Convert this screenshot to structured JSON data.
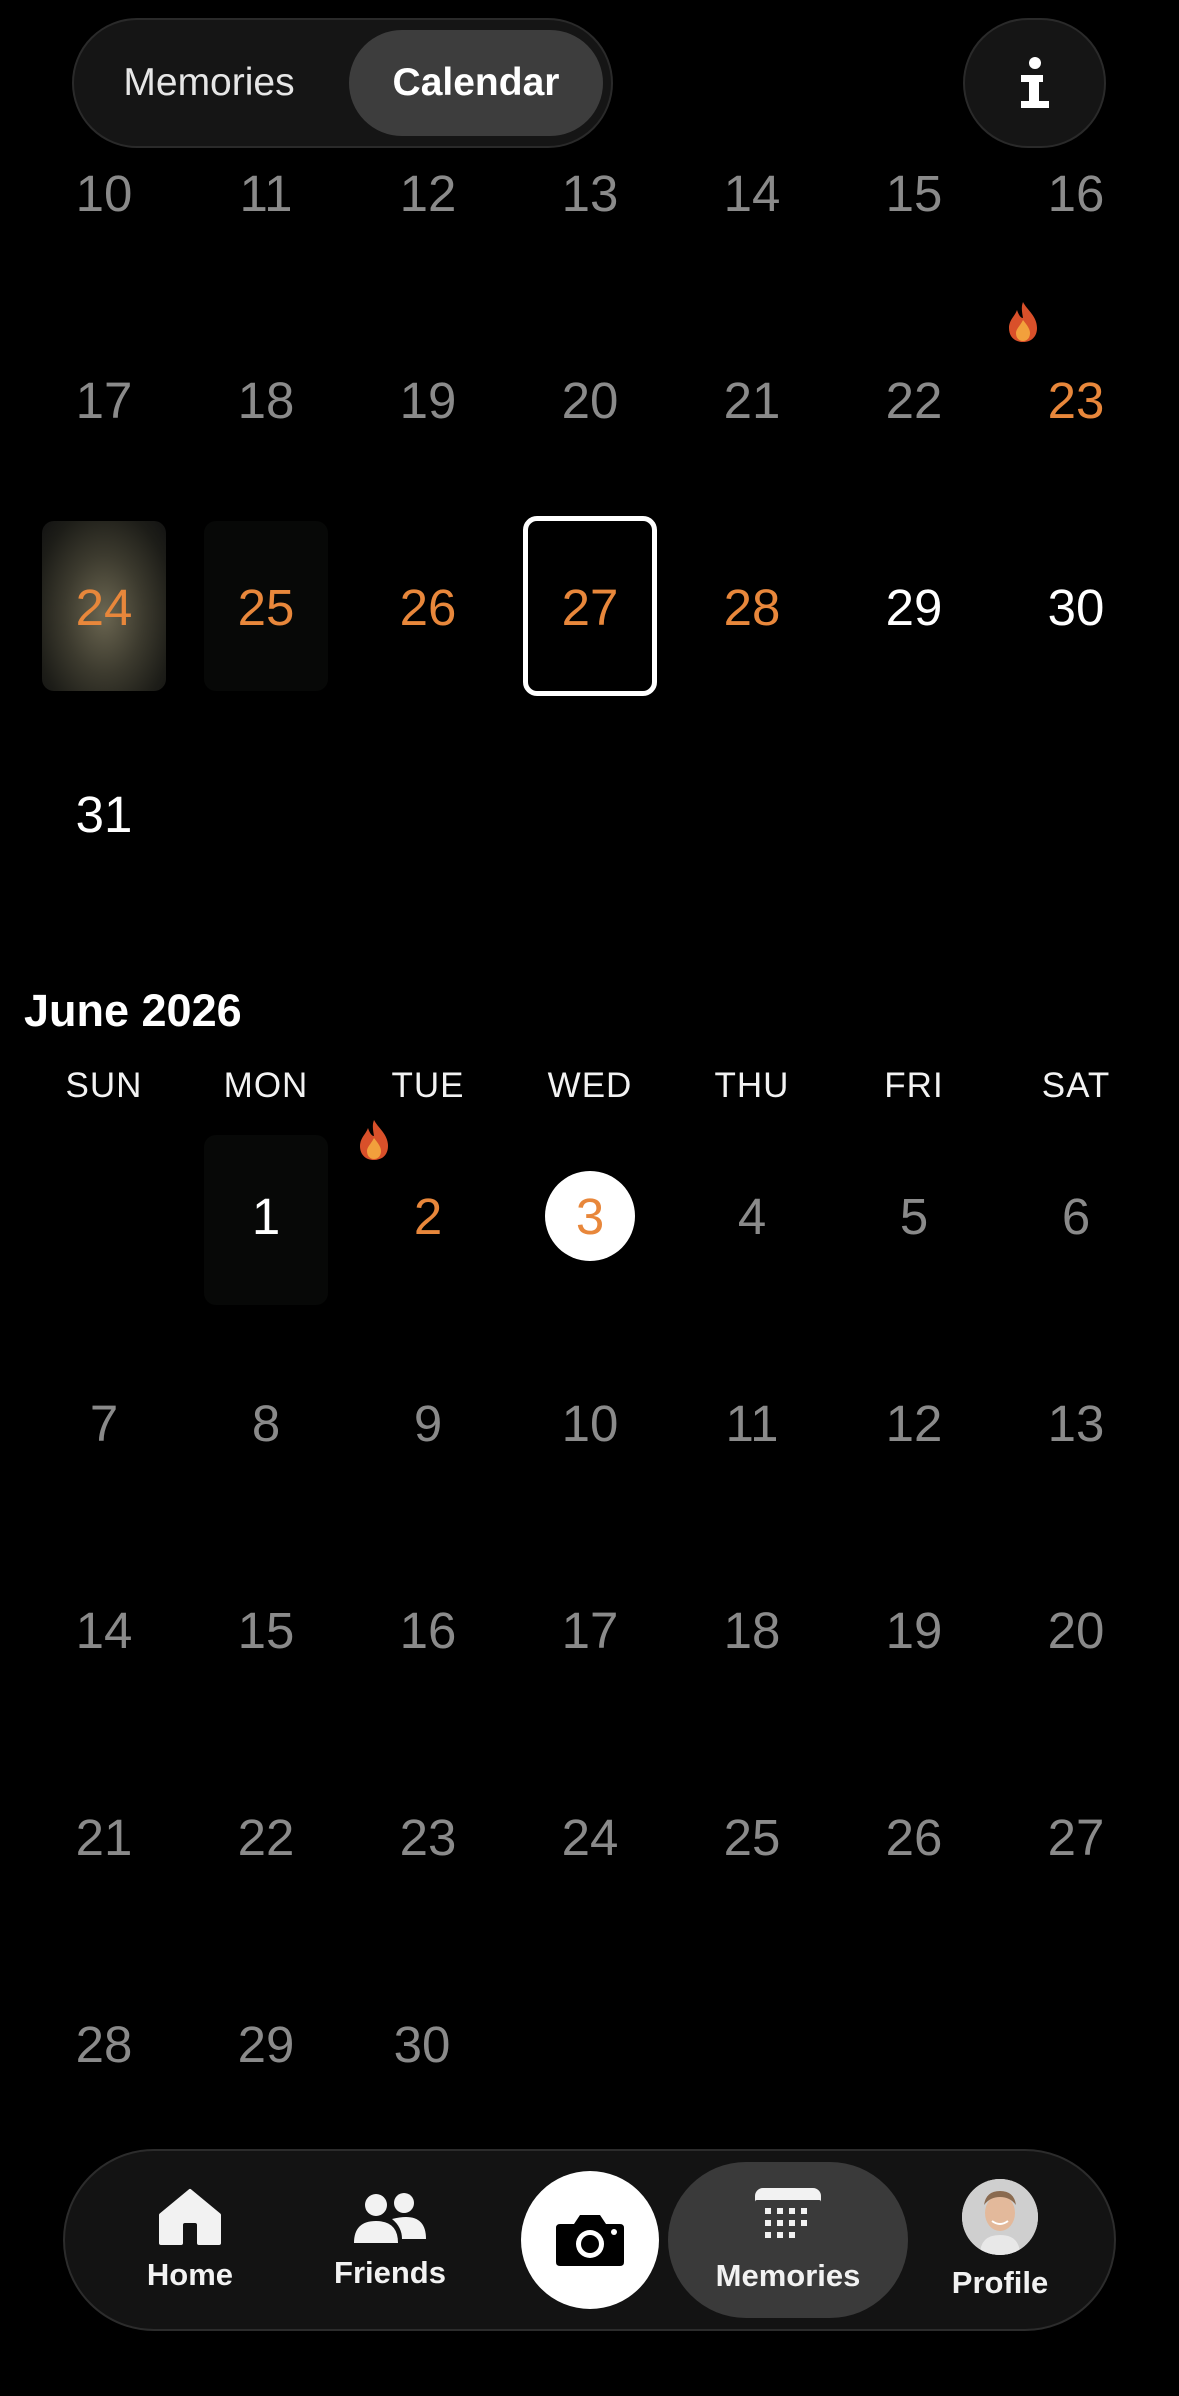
{
  "header": {
    "segments": [
      "Memories",
      "Calendar"
    ],
    "active_segment": "Calendar",
    "info_label": "i"
  },
  "may": {
    "row1": [
      "10",
      "11",
      "12",
      "13",
      "14",
      "15",
      "16"
    ],
    "row2": [
      "17",
      "18",
      "19",
      "20",
      "21",
      "22",
      "23"
    ],
    "row3": [
      "24",
      "25",
      "26",
      "27",
      "28",
      "29",
      "30"
    ],
    "row4": [
      "31"
    ]
  },
  "june": {
    "title": "June 2026",
    "weekdays": [
      "SUN",
      "MON",
      "TUE",
      "WED",
      "THU",
      "FRI",
      "SAT"
    ],
    "row1": [
      "1",
      "2",
      "3",
      "4",
      "5",
      "6"
    ],
    "row2": [
      "7",
      "8",
      "9",
      "10",
      "11",
      "12",
      "13"
    ],
    "row3": [
      "14",
      "15",
      "16",
      "17",
      "18",
      "19",
      "20"
    ],
    "row4": [
      "21",
      "22",
      "23",
      "24",
      "25",
      "26",
      "27"
    ],
    "row5": [
      "28",
      "29",
      "30"
    ]
  },
  "colors": {
    "accent": "#e8873b",
    "muted": "#8a8a8a",
    "background": "#000000"
  },
  "tabbar": {
    "home": "Home",
    "friends": "Friends",
    "camera_icon": "camera-icon",
    "memories": "Memories",
    "profile": "Profile",
    "active": "Memories"
  }
}
